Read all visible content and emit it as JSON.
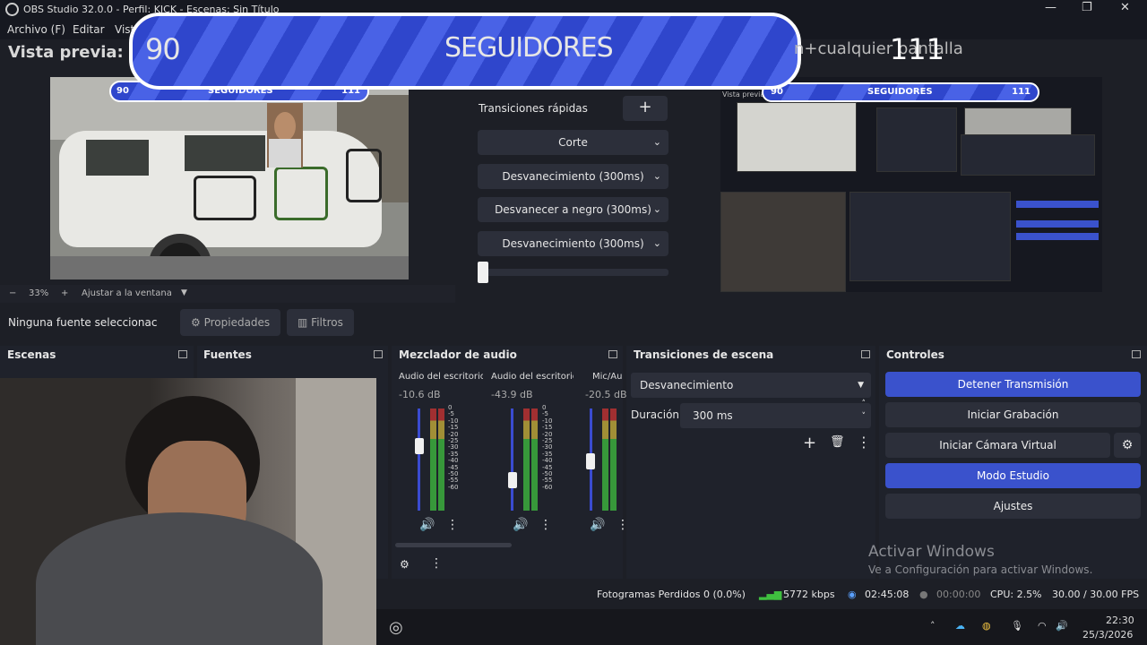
{
  "window": {
    "title": "OBS Studio 32.0.0 - Perfil: KICK - Escenas: Sin Título",
    "minimize_icon": "minimize-icon",
    "maximize_icon": "maximize-icon",
    "close_icon": "close-icon"
  },
  "menu": [
    "Archivo (F)",
    "Editar",
    "Vist"
  ],
  "preview": {
    "header_left": "Vista previa: C",
    "header_right": "n+cualquier pantalla",
    "zoom": "33%",
    "fit_label": "Ajustar a la ventana"
  },
  "banner": {
    "left_count": "90",
    "label": "SEGUIDORES",
    "right_count": "111"
  },
  "quick_transitions": {
    "label": "Transiciones rápidas",
    "buttons": [
      "Corte",
      "Desvanecimiento (300ms)",
      "Desvanecer a negro (300ms)",
      "Desvanecimiento (300ms)"
    ],
    "slider_value": 0
  },
  "properties_bar": {
    "no_source": "Ninguna fuente seleccionac",
    "properties": "Propiedades",
    "filters": "Filtros"
  },
  "docks": {
    "scenes": "Escenas",
    "sources": "Fuentes",
    "mixer": "Mezclador de audio",
    "transitions": "Transiciones de escena",
    "controls": "Controles"
  },
  "mixer": {
    "channels": [
      {
        "name": "Audio del escritorio",
        "db": "-10.6 dB",
        "level": 0.68
      },
      {
        "name": "Audio del escritorio",
        "db": "-43.9 dB",
        "level": 0.3
      },
      {
        "name": "Mic/Au",
        "db": "-20.5 dB",
        "level": 0.48
      }
    ],
    "scale": [
      "0",
      "-5",
      "-10",
      "-15",
      "-20",
      "-25",
      "-30",
      "-35",
      "-40",
      "-45",
      "-50",
      "-55",
      "-60"
    ]
  },
  "scene_transitions": {
    "selected": "Desvanecimiento",
    "duration_label": "Duración",
    "duration": "300 ms"
  },
  "controls": {
    "stop_stream": "Detener Transmisión",
    "start_recording": "Iniciar Grabación",
    "start_virtual_cam": "Iniciar Cámara Virtual",
    "studio_mode": "Modo Estudio",
    "settings": "Ajustes"
  },
  "activate_windows": {
    "title": "Activar Windows",
    "subtitle": "Ve a Configuración para activar Windows."
  },
  "status": {
    "dropped_frames": "Fotogramas Perdidos 0 (0.0%)",
    "bitrate": "5772 kbps",
    "stream_time": "02:45:08",
    "rec_time": "00:00:00",
    "cpu": "CPU: 2.5%",
    "fps": "30.00 / 30.00 FPS"
  },
  "taskbar": {
    "time": "22:30",
    "date": "25/3/2026"
  },
  "colors": {
    "accent": "#3a52cc",
    "panel": "#1f222b",
    "button": "#2c2f3a"
  }
}
